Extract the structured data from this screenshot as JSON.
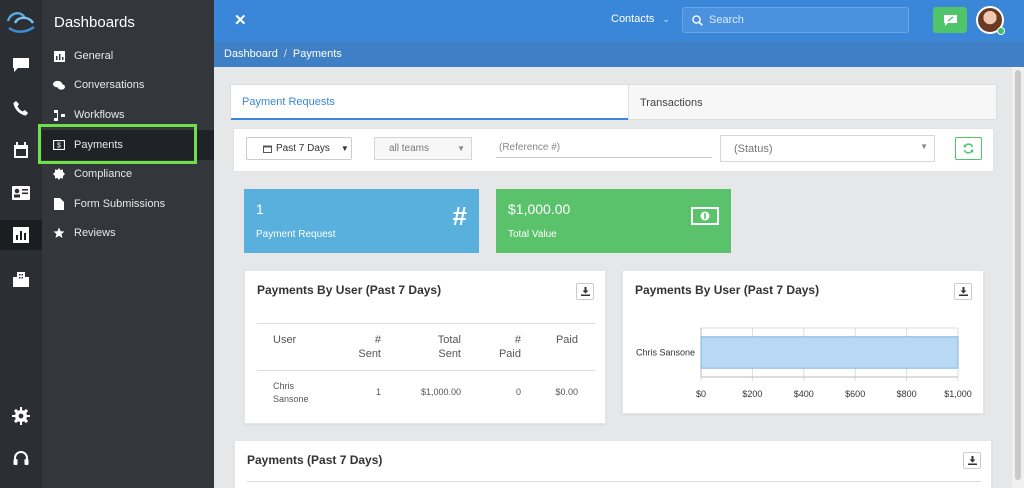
{
  "sidebar": {
    "title": "Dashboards",
    "items": [
      {
        "label": "General",
        "icon": "bar-chart-icon"
      },
      {
        "label": "Conversations",
        "icon": "chat-bubbles-icon"
      },
      {
        "label": "Workflows",
        "icon": "workflow-icon"
      },
      {
        "label": "Payments",
        "icon": "money-icon"
      },
      {
        "label": "Compliance",
        "icon": "badge-icon"
      },
      {
        "label": "Form Submissions",
        "icon": "document-icon"
      },
      {
        "label": "Reviews",
        "icon": "star-icon"
      }
    ]
  },
  "rail": {
    "icons": [
      "chat-icon",
      "phone-icon",
      "calendar-icon",
      "contact-card-icon",
      "bar-chart-icon",
      "building-icon",
      "gear-icon",
      "headset-icon"
    ]
  },
  "topbar": {
    "contacts_label": "Contacts",
    "search_placeholder": "Search"
  },
  "breadcrumb": {
    "root": "Dashboard",
    "separator": "/",
    "current": "Payments"
  },
  "tabs": {
    "active": "Payment Requests",
    "inactive": "Transactions"
  },
  "filters": {
    "date_range": "Past 7 Days",
    "teams": "all teams",
    "reference_placeholder": "(Reference #)",
    "status": "(Status)"
  },
  "stats": {
    "requests": {
      "value": "1",
      "label": "Payment Request"
    },
    "total": {
      "value": "$1,000.00",
      "label": "Total Value"
    }
  },
  "user_table": {
    "title": "Payments By User (Past 7 Days)",
    "headers": {
      "user": "User",
      "sent_a": "#",
      "sent_b": "Sent",
      "total_a": "Total",
      "total_b": "Sent",
      "paid_a": "#",
      "paid_b": "Paid",
      "paid_amt": "Paid"
    },
    "rows": [
      {
        "user_a": "Chris",
        "user_b": "Sansone",
        "sent": "1",
        "total": "$1,000.00",
        "paid": "0",
        "paid_amt": "$0.00"
      }
    ]
  },
  "user_chart_title": "Payments By User (Past 7 Days)",
  "bottom_title": "Payments (Past 7 Days)",
  "colors": {
    "topbar": "#3a86d8",
    "accent_green": "#5bc26c",
    "accent_blue": "#5ab0dc",
    "highlight": "#6ee04a"
  },
  "chart_data": {
    "type": "bar",
    "orientation": "horizontal",
    "categories": [
      "Chris Sansone"
    ],
    "values": [
      1000
    ],
    "xlim": [
      0,
      1000
    ],
    "x_ticks": [
      "$0",
      "$200",
      "$400",
      "$600",
      "$800",
      "$1,000"
    ],
    "grid": true
  }
}
